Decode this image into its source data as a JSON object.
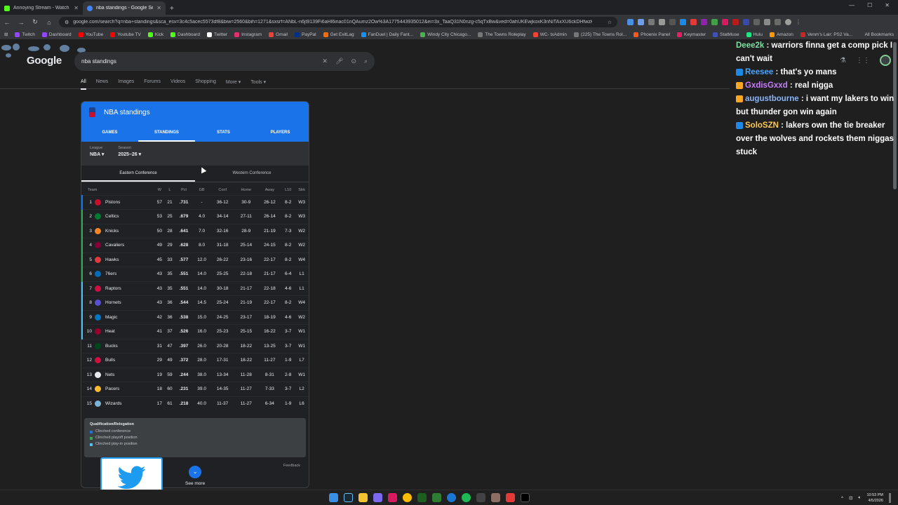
{
  "browser": {
    "tabs": [
      {
        "title": "Annoying Stream - Watch Live",
        "color": "#53fc18",
        "active": false
      },
      {
        "title": "nba standings - Google Search",
        "color": "#4285f4",
        "active": true
      }
    ],
    "new_tab": "+",
    "url": "google.com/search?q=nba+standings&sca_esv=3c4c5acec5573df8&biw=2560&bih=1271&sxsrf=ANbL-n6jt9139Fi6aHl6inac01nQAumz2Ow%3A1775443935012&ei=3x_TaaQ31N0nzg-c5qTxBw&ved=0ahUKEwjkoxK3nNiTAxXU6ckDHfwzKX4Q4dUDCBM",
    "bookmarks": [
      "Twitch",
      "Dashboard",
      "YouTube",
      "Youtube TV",
      "Kick",
      "Dashboard",
      "Twitter",
      "Instagram",
      "Gmail",
      "PayPal",
      "Get ExitLag",
      "FanDuel | Daily Fant...",
      "Windy City Chicago...",
      "The Towns Roleplay",
      "WC- txAdmin",
      "(225) The Towns Rol...",
      "Phoenix Panel",
      "Keymaster",
      "StatMuse",
      "Hulu",
      "Amazon",
      "Venm's Lair: PS2 Va..."
    ],
    "all_bookmarks": "All Bookmarks"
  },
  "google": {
    "logo": "Google",
    "query": "nba standings",
    "tabs": [
      "All",
      "News",
      "Images",
      "Forums",
      "Videos",
      "Shopping",
      "More ▾",
      "Tools ▾"
    ]
  },
  "card": {
    "title": "NBA standings",
    "tabs": [
      "GAMES",
      "STANDINGS",
      "STATS",
      "PLAYERS"
    ],
    "league_label": "League",
    "league_value": "NBA ▾",
    "season_label": "Season",
    "season_value": "2025–26 ▾",
    "conferences": [
      "Eastern Conference",
      "Western Conference"
    ],
    "columns": [
      "Team",
      "W",
      "L",
      "Pct",
      "GB",
      "Conf",
      "Home",
      "Away",
      "L10",
      "Strk"
    ],
    "rows": [
      {
        "rank": "1",
        "team": "Pistons",
        "w": "57",
        "l": "21",
        "pct": ".731",
        "gb": "-",
        "conf": "36-12",
        "home": "30-9",
        "away": "26-12",
        "l10": "8-2",
        "strk": "W3",
        "color": "#c8102e",
        "tier": "#1a73e8"
      },
      {
        "rank": "2",
        "team": "Celtics",
        "w": "53",
        "l": "25",
        "pct": ".679",
        "gb": "4.0",
        "conf": "34-14",
        "home": "27-11",
        "away": "26-14",
        "l10": "8-2",
        "strk": "W3",
        "color": "#007a33",
        "tier": "#34a853"
      },
      {
        "rank": "3",
        "team": "Knicks",
        "w": "50",
        "l": "28",
        "pct": ".641",
        "gb": "7.0",
        "conf": "32-16",
        "home": "28-9",
        "away": "21-19",
        "l10": "7-3",
        "strk": "W2",
        "color": "#f58426",
        "tier": "#34a853"
      },
      {
        "rank": "4",
        "team": "Cavaliers",
        "w": "49",
        "l": "29",
        "pct": ".628",
        "gb": "8.0",
        "conf": "31-18",
        "home": "25-14",
        "away": "24-15",
        "l10": "8-2",
        "strk": "W2",
        "color": "#860038",
        "tier": "#34a853"
      },
      {
        "rank": "5",
        "team": "Hawks",
        "w": "45",
        "l": "33",
        "pct": ".577",
        "gb": "12.0",
        "conf": "26-22",
        "home": "23-16",
        "away": "22-17",
        "l10": "8-2",
        "strk": "W4",
        "color": "#e03a3e",
        "tier": "#34a853"
      },
      {
        "rank": "6",
        "team": "76ers",
        "w": "43",
        "l": "35",
        "pct": ".551",
        "gb": "14.0",
        "conf": "25-25",
        "home": "22-18",
        "away": "21-17",
        "l10": "6-4",
        "strk": "L1",
        "color": "#006bb6",
        "tier": "#34a853"
      },
      {
        "rank": "7",
        "team": "Raptors",
        "w": "43",
        "l": "35",
        "pct": ".551",
        "gb": "14.0",
        "conf": "30-18",
        "home": "21-17",
        "away": "22-18",
        "l10": "4-6",
        "strk": "L1",
        "color": "#ce1141",
        "tier": "#4fc3f7"
      },
      {
        "rank": "8",
        "team": "Hornets",
        "w": "43",
        "l": "36",
        "pct": ".544",
        "gb": "14.5",
        "conf": "25-24",
        "home": "21-19",
        "away": "22-17",
        "l10": "8-2",
        "strk": "W4",
        "color": "#5a4fcf",
        "tier": "#4fc3f7"
      },
      {
        "rank": "9",
        "team": "Magic",
        "w": "42",
        "l": "36",
        "pct": ".538",
        "gb": "15.0",
        "conf": "24-25",
        "home": "23-17",
        "away": "18-19",
        "l10": "4-6",
        "strk": "W2",
        "color": "#0077c0",
        "tier": "#4fc3f7"
      },
      {
        "rank": "10",
        "team": "Heat",
        "w": "41",
        "l": "37",
        "pct": ".526",
        "gb": "16.0",
        "conf": "25-23",
        "home": "25-15",
        "away": "16-22",
        "l10": "3-7",
        "strk": "W1",
        "color": "#98002e",
        "tier": "#4fc3f7"
      },
      {
        "rank": "11",
        "team": "Bucks",
        "w": "31",
        "l": "47",
        "pct": ".397",
        "gb": "26.0",
        "conf": "20-28",
        "home": "18-22",
        "away": "13-25",
        "l10": "3-7",
        "strk": "W1",
        "color": "#00471b",
        "tier": "transparent"
      },
      {
        "rank": "12",
        "team": "Bulls",
        "w": "29",
        "l": "49",
        "pct": ".372",
        "gb": "28.0",
        "conf": "17-31",
        "home": "18-22",
        "away": "11-27",
        "l10": "1-9",
        "strk": "L7",
        "color": "#ce1141",
        "tier": "transparent"
      },
      {
        "rank": "13",
        "team": "Nets",
        "w": "19",
        "l": "59",
        "pct": ".244",
        "gb": "38.0",
        "conf": "13-34",
        "home": "11-28",
        "away": "8-31",
        "l10": "2-8",
        "strk": "W1",
        "color": "#e8eaed",
        "tier": "transparent"
      },
      {
        "rank": "14",
        "team": "Pacers",
        "w": "18",
        "l": "60",
        "pct": ".231",
        "gb": "39.0",
        "conf": "14-35",
        "home": "11-27",
        "away": "7-33",
        "l10": "3-7",
        "strk": "L2",
        "color": "#fdbb30",
        "tier": "transparent"
      },
      {
        "rank": "15",
        "team": "Wizards",
        "w": "17",
        "l": "61",
        "pct": ".218",
        "gb": "40.0",
        "conf": "11-37",
        "home": "11-27",
        "away": "6-34",
        "l10": "1-9",
        "strk": "L6",
        "color": "#7ab3d6",
        "tier": "transparent"
      }
    ],
    "qualification": {
      "title": "Qualification/Relegation",
      "items": [
        {
          "label": "Clinched conference",
          "color": "#1a73e8"
        },
        {
          "label": "Clinched playoff position",
          "color": "#34a853"
        },
        {
          "label": "Clinched play-in position",
          "color": "#4fc3f7"
        }
      ]
    },
    "see_more": "See more",
    "feedback": "Feedback"
  },
  "chat": [
    {
      "user": "Deee2k",
      "user_color": "#7ee0a3",
      "text": " : warriors finna get a comp pick I can't wait"
    },
    {
      "user": "Reesee",
      "user_color": "#4aa3ff",
      "text": " : that's yo mans"
    },
    {
      "user": "GxdisGxxd",
      "user_color": "#c77dff",
      "text": " : real nigga"
    },
    {
      "user": "augustbourne",
      "user_color": "#8ab4f8",
      "text": " : i want my lakers to win but thunder gon win again"
    },
    {
      "user": "SoloSZN",
      "user_color": "#ffc857",
      "text": " : lakers own the tie breaker over the wolves and rockets them niggas stuck"
    }
  ],
  "taskbar": {
    "time": "10:53 PM",
    "date": "4/5/2026"
  }
}
